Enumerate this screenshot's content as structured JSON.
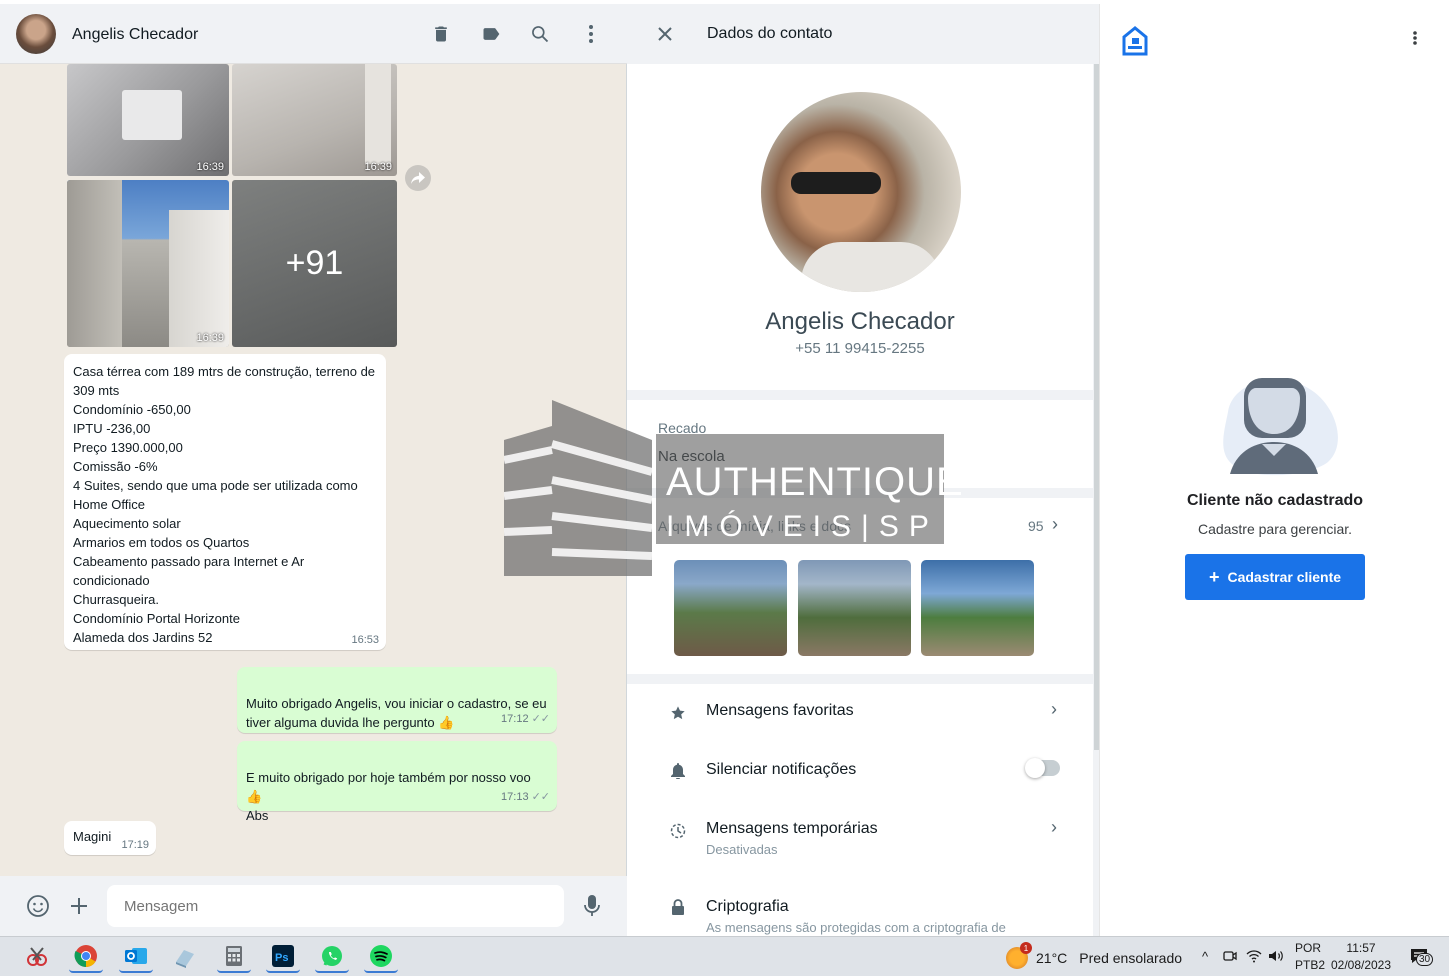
{
  "chat": {
    "contact_name": "Angelis Checador",
    "header_icons": [
      "delete-icon",
      "label-icon",
      "search-icon",
      "menu-icon"
    ],
    "photos": [
      {
        "time": "16:39"
      },
      {
        "time": "16:39"
      },
      {
        "time": "16:39"
      },
      {
        "overlay": "+91"
      }
    ],
    "description": {
      "text": "Casa térrea com 189 mtrs de construção, terreno de 309 mts\nCondomínio -650,00\nIPTU -236,00\nPreço 1390.000,00\nComissão -6%\n4 Suites, sendo que uma pode ser utilizada como Home Office\nAquecimento solar\nArmarios em todos os Quartos\nCabeamento passado para Internet e Ar condicionado\nChurrasqueira.\nCondomínio Portal Horizonte\nAlameda dos Jardins 52",
      "time": "16:53"
    },
    "outgoing": [
      {
        "text": "Muito obrigado Angelis, vou iniciar o cadastro, se eu tiver alguma duvida lhe pergunto 👍",
        "time": "17:12"
      },
      {
        "text": "E muito obrigado por hoje também por nosso voo 👍\nAbs",
        "time": "17:13"
      }
    ],
    "incoming_last": {
      "text": "Magini",
      "time": "17:19"
    },
    "input_placeholder": "Mensagem"
  },
  "contact_panel": {
    "title": "Dados do contato",
    "name": "Angelis Checador",
    "phone": "+55 11 99415-2255",
    "about_label": "Recado",
    "about_text": "Na escola",
    "media_label": "Arquivos de mídia, links e docs",
    "media_count": "95",
    "options": [
      {
        "label": "Mensagens favoritas",
        "icon": "star-icon"
      },
      {
        "label": "Silenciar notificações",
        "icon": "bell-icon",
        "toggle": false
      },
      {
        "label": "Mensagens temporárias",
        "sub": "Desativadas",
        "icon": "timer-icon"
      },
      {
        "label": "Criptografia",
        "sub": "As mensagens são protegidas com a criptografia de",
        "icon": "lock-icon"
      }
    ]
  },
  "crm_panel": {
    "title": "Cliente não cadastrado",
    "subtitle": "Cadastre para gerenciar.",
    "button_label": "Cadastrar cliente",
    "accent": "#1a73e8"
  },
  "watermark": {
    "word": "AUTHENTIQUE",
    "sub": "IMÓVEIS|SP"
  },
  "taskbar": {
    "apps": [
      "snipping-tool-icon",
      "chrome-icon",
      "outlook-icon",
      "files-icon",
      "calculator-icon",
      "photoshop-icon",
      "whatsapp-icon",
      "spotify-icon"
    ],
    "weather_badge": "1",
    "weather_temp": "21°C",
    "weather_desc": "Pred ensolarado",
    "lang_line1": "POR",
    "lang_line2": "PTB2",
    "time": "11:57",
    "date": "02/08/2023",
    "notification_count": "30"
  }
}
